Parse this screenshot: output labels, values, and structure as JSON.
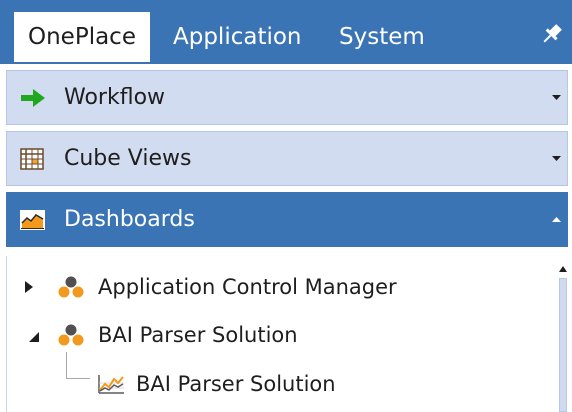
{
  "tabs": [
    {
      "label": "OnePlace",
      "active": true
    },
    {
      "label": "Application",
      "active": false
    },
    {
      "label": "System",
      "active": false
    }
  ],
  "pin_icon": "pin-icon",
  "sections": [
    {
      "label": "Workflow",
      "icon": "green-arrow-right-icon",
      "expanded": false
    },
    {
      "label": "Cube Views",
      "icon": "grid-table-icon",
      "expanded": false
    },
    {
      "label": "Dashboards",
      "icon": "area-chart-icon",
      "expanded": true
    }
  ],
  "tree": {
    "items": [
      {
        "label": "Application Control Manager",
        "icon": "group-circles-icon",
        "expanded": false
      },
      {
        "label": "BAI Parser Solution",
        "icon": "group-circles-icon",
        "expanded": true,
        "children": [
          {
            "label": "BAI Parser Solution",
            "icon": "line-chart-icon"
          }
        ]
      }
    ]
  },
  "colors": {
    "accent": "#3a74b5",
    "section_bg": "#d2dcf0",
    "workflow_arrow": "#1fa81f",
    "cluster_orange": "#f39a1e",
    "cluster_dark": "#505050"
  }
}
